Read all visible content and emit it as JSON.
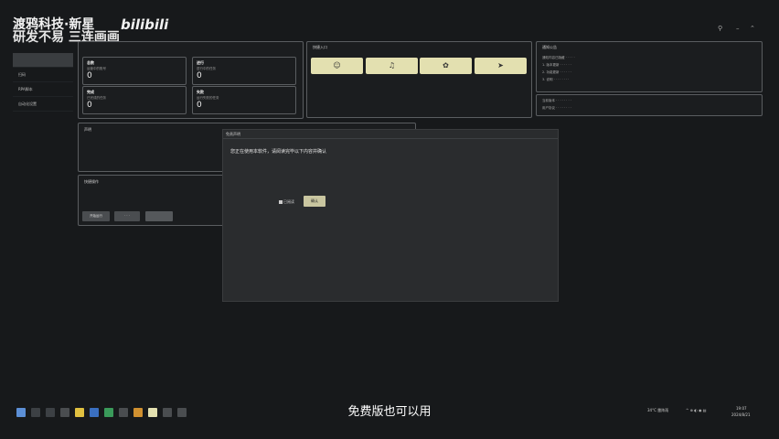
{
  "watermark": {
    "line1": "渡鸦科技·新星",
    "line2": "研发不易 三连画画",
    "logo_text": "bilibili"
  },
  "window_controls": [
    "⚲",
    "–",
    "⌃"
  ],
  "sidebar": {
    "items": [
      {
        "label": "",
        "active": true
      },
      {
        "label": "扫码",
        "active": false
      },
      {
        "label": "RPA脚本",
        "active": false
      },
      {
        "label": "自动化设置",
        "active": false
      }
    ]
  },
  "stats": [
    {
      "badge": "总数",
      "desc": "运营中的账号",
      "value": "0"
    },
    {
      "badge": "进行",
      "desc": "进行中的任务",
      "value": "0"
    },
    {
      "badge": "完成",
      "desc": "已完成的任务",
      "value": "0"
    },
    {
      "badge": "失败",
      "desc": "运行失败的任务",
      "value": "0"
    }
  ],
  "quick": {
    "title": "快捷入口",
    "buttons": [
      {
        "icon": "user-icon",
        "glyph": "☺"
      },
      {
        "icon": "bell-icon",
        "glyph": "♫"
      },
      {
        "icon": "settings-icon",
        "glyph": "✿"
      },
      {
        "icon": "send-icon",
        "glyph": "➤"
      }
    ]
  },
  "notice": {
    "title": "通知公告",
    "lines": [
      "通知内容已隐藏 · · · · ·",
      "1. 版本更新 · · · · · ·",
      "2. 功能更新 · · · · · ·",
      "3. 说明 · · · · · · · ·"
    ]
  },
  "info": {
    "line1": "当前版本 · · · · · · · ·",
    "line2": "用户协议 · · · · · · · ·"
  },
  "declare": {
    "title": "声明"
  },
  "actions": {
    "title": "快捷操作",
    "btn1": "开始运行",
    "btn2": "· · ·",
    "btn3": ""
  },
  "modal": {
    "title": "免责声明",
    "text": "您正在使用本软件，请阅读完毕以下内容并确认",
    "checkbox_label": "已阅读",
    "confirm_label": "确认"
  },
  "subtitle": "免费版也可以用",
  "taskbar": {
    "weather": "34°C 雷阵雨",
    "time": "19:07",
    "date": "2024/8/21"
  },
  "colors": {
    "accent": "#e3e0b0",
    "bg": "#17191b"
  }
}
